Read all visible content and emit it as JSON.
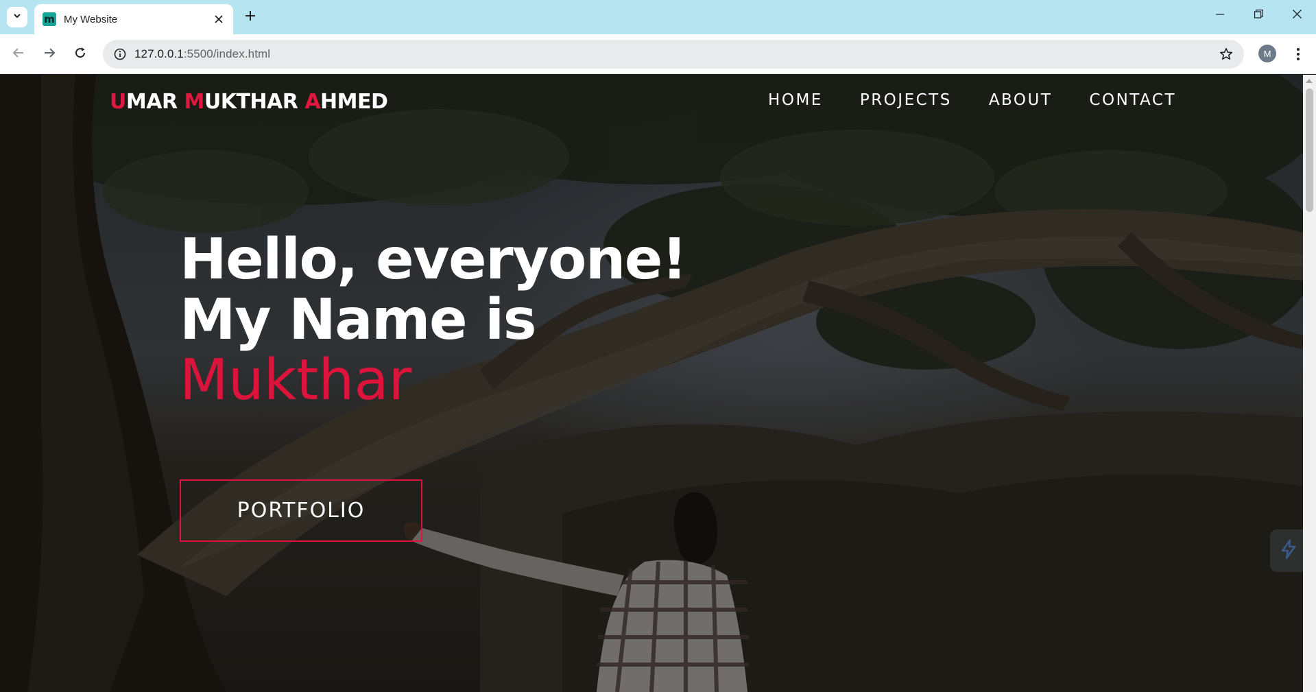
{
  "browser": {
    "tab_title": "My Website",
    "favicon_letter": "m",
    "url_host": "127.0.0.1",
    "url_path": ":5500/index.html",
    "profile_initial": "M"
  },
  "site": {
    "logo": {
      "umar_initial": "U",
      "umar_rest": "MAR ",
      "mukthar_initial": "M",
      "mukthar_rest": "UKTHAR ",
      "ahmed_initial": "A",
      "ahmed_rest": "HMED"
    },
    "nav": [
      "HOME",
      "PROJECTS",
      "ABOUT",
      "CONTACT"
    ],
    "hero": {
      "line1": "Hello, everyone!",
      "line2": "My Name is",
      "name": "Mukthar"
    },
    "cta_label": "PORTFOLIO"
  },
  "colors": {
    "accent": "#dc143c",
    "tabbar": "#b6e4f1"
  }
}
